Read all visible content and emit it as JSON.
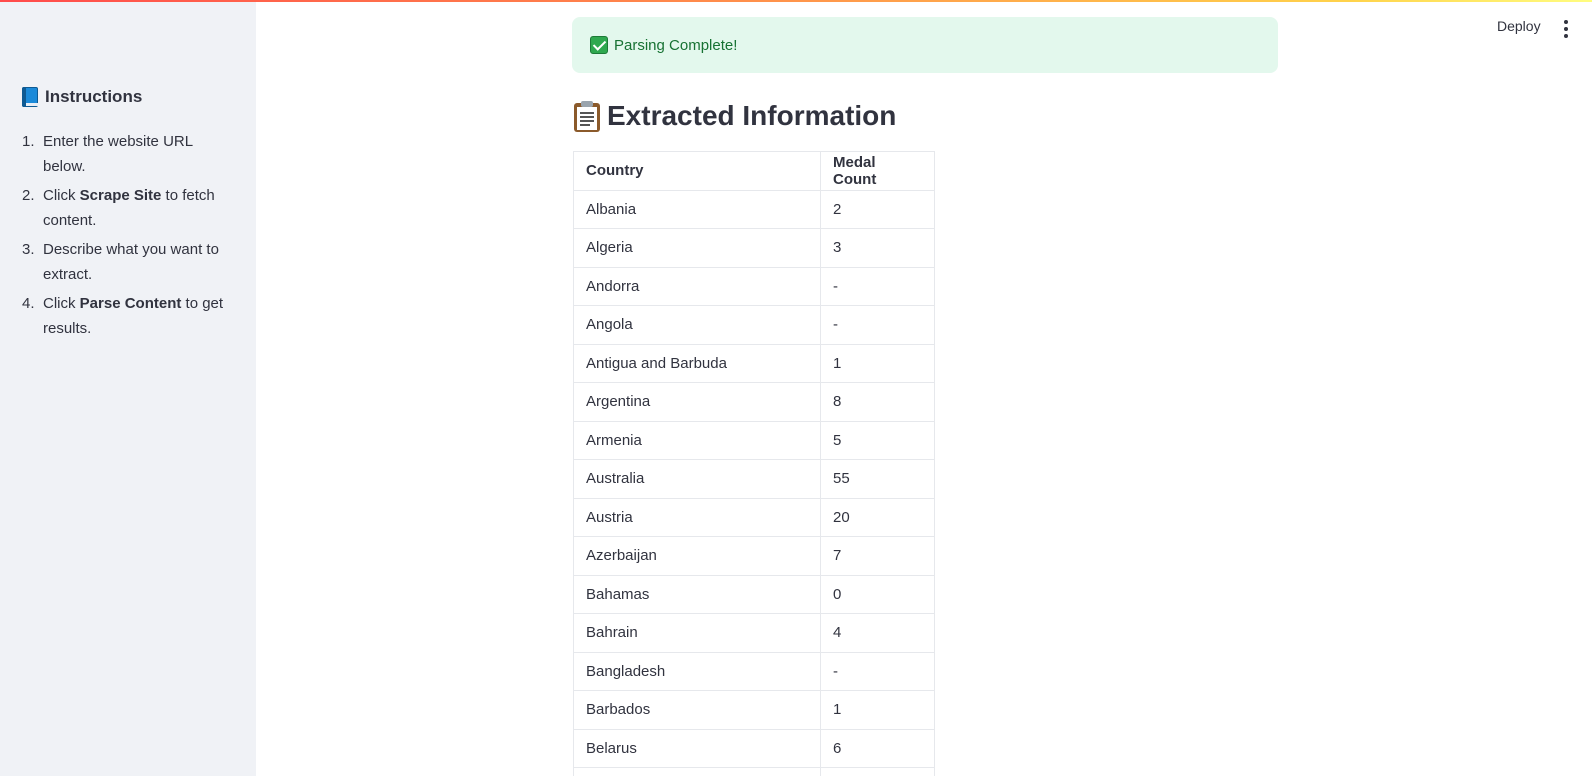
{
  "sidebar": {
    "title": "Instructions",
    "title_icon": "blue-book-icon",
    "steps": [
      {
        "number": "1.",
        "before": "Enter the website URL below.",
        "bold": "",
        "after": ""
      },
      {
        "number": "2.",
        "before": "Click ",
        "bold": "Scrape Site",
        "after": " to fetch content."
      },
      {
        "number": "3.",
        "before": "Describe what you want to extract.",
        "bold": "",
        "after": ""
      },
      {
        "number": "4.",
        "before": "Click ",
        "bold": "Parse Content",
        "after": " to get results."
      }
    ]
  },
  "header": {
    "deploy_label": "Deploy",
    "menu_icon": "vertical-ellipsis-icon"
  },
  "alert": {
    "icon": "check-mark-icon",
    "text": "Parsing Complete!",
    "colors": {
      "background": "#e3f8ed",
      "text": "#177233"
    }
  },
  "main": {
    "heading": "Extracted Information",
    "heading_icon": "clipboard-icon"
  },
  "table": {
    "columns": [
      "Country",
      "Medal Count"
    ],
    "rows": [
      [
        "Albania",
        "2"
      ],
      [
        "Algeria",
        "3"
      ],
      [
        "Andorra",
        "-"
      ],
      [
        "Angola",
        "-"
      ],
      [
        "Antigua and Barbuda",
        "1"
      ],
      [
        "Argentina",
        "8"
      ],
      [
        "Armenia",
        "5"
      ],
      [
        "Australia",
        "55"
      ],
      [
        "Austria",
        "20"
      ],
      [
        "Azerbaijan",
        "7"
      ],
      [
        "Bahamas",
        "0"
      ],
      [
        "Bahrain",
        "4"
      ],
      [
        "Bangladesh",
        "-"
      ],
      [
        "Barbados",
        "1"
      ],
      [
        "Belarus",
        "6"
      ],
      [
        "",
        ""
      ]
    ]
  }
}
